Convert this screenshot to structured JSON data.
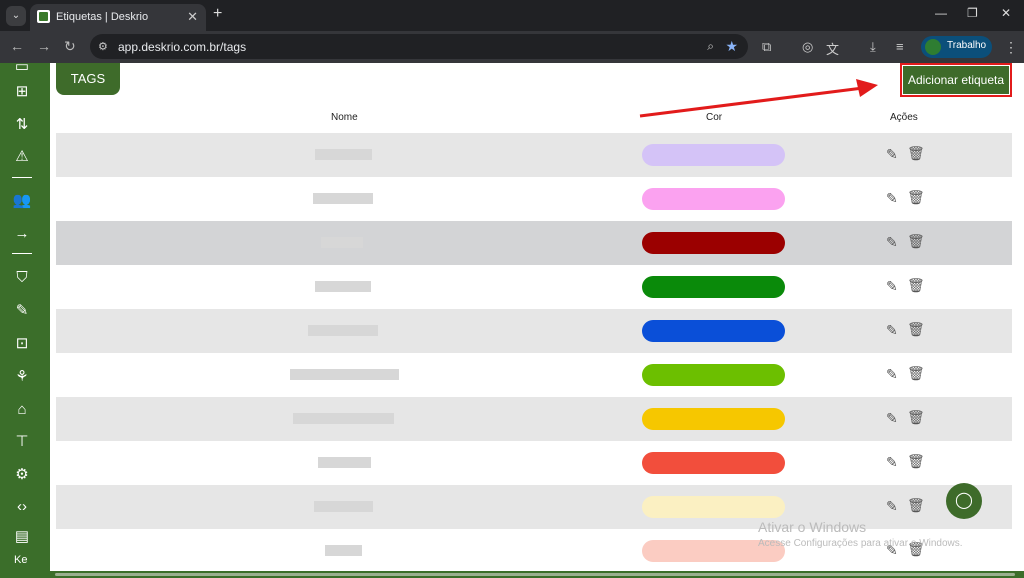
{
  "browser": {
    "tab_title": "Etiquetas | Deskrio",
    "url": "app.deskrio.com.br/tags",
    "profile_name": "Trabalho"
  },
  "sidebar": {
    "user_initials": "Ke"
  },
  "page": {
    "badge": "TAGS",
    "add_button": "Adicionar etiqueta",
    "columns": {
      "name": "Nome",
      "color": "Cor",
      "actions": "Ações"
    }
  },
  "tags": [
    {
      "color": "#d4c3f7"
    },
    {
      "color": "#fba2f0"
    },
    {
      "color": "#9b0000"
    },
    {
      "color": "#0a8a0a"
    },
    {
      "color": "#0a4fd8"
    },
    {
      "color": "#6cbf00"
    },
    {
      "color": "#f6c700"
    },
    {
      "color": "#f24e3c"
    },
    {
      "color": "#fbf0c2"
    },
    {
      "color": "#fbccc2"
    }
  ],
  "watermark": {
    "line1": "Ativar o Windows",
    "line2": "Acesse Configurações para ativar o Windows."
  }
}
